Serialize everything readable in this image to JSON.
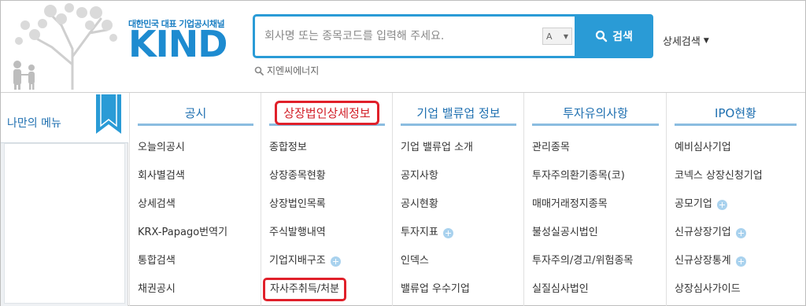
{
  "header": {
    "logo_tagline": "대한민국 대표 기업공시채널",
    "logo_text": "KIND",
    "search_placeholder": "회사명 또는 종목코드를 입력해 주세요.",
    "lang_label": "A",
    "search_button": "검색",
    "advanced_search": "상세검색",
    "recent_keyword": "지엔씨에너지"
  },
  "my_menu": {
    "title": "나만의 메뉴"
  },
  "columns": [
    {
      "title": "공시",
      "highlight": false,
      "items": [
        {
          "label": "오늘의공시",
          "plus": false,
          "highlight": false
        },
        {
          "label": "회사별검색",
          "plus": false,
          "highlight": false
        },
        {
          "label": "상세검색",
          "plus": false,
          "highlight": false
        },
        {
          "label": "KRX-Papago번역기",
          "plus": false,
          "highlight": false
        },
        {
          "label": "통합검색",
          "plus": false,
          "highlight": false
        },
        {
          "label": "채권공시",
          "plus": false,
          "highlight": false
        }
      ]
    },
    {
      "title": "상장법인상세정보",
      "highlight": true,
      "items": [
        {
          "label": "종합정보",
          "plus": false,
          "highlight": false
        },
        {
          "label": "상장종목현황",
          "plus": false,
          "highlight": false
        },
        {
          "label": "상장법인목록",
          "plus": false,
          "highlight": false
        },
        {
          "label": "주식발행내역",
          "plus": false,
          "highlight": false
        },
        {
          "label": "기업지배구조",
          "plus": true,
          "highlight": false
        },
        {
          "label": "자사주취득/처분",
          "plus": false,
          "highlight": true
        }
      ]
    },
    {
      "title": "기업 밸류업 정보",
      "highlight": false,
      "items": [
        {
          "label": "기업 밸류업 소개",
          "plus": false,
          "highlight": false
        },
        {
          "label": "공지사항",
          "plus": false,
          "highlight": false
        },
        {
          "label": "공시현황",
          "plus": false,
          "highlight": false
        },
        {
          "label": "투자지표",
          "plus": true,
          "highlight": false
        },
        {
          "label": "인덱스",
          "plus": false,
          "highlight": false
        },
        {
          "label": "밸류업 우수기업",
          "plus": false,
          "highlight": false
        }
      ]
    },
    {
      "title": "투자유의사항",
      "highlight": false,
      "items": [
        {
          "label": "관리종목",
          "plus": false,
          "highlight": false
        },
        {
          "label": "투자주의환기종목(코)",
          "plus": false,
          "highlight": false
        },
        {
          "label": "매매거래정지종목",
          "plus": false,
          "highlight": false
        },
        {
          "label": "불성실공시법인",
          "plus": false,
          "highlight": false
        },
        {
          "label": "투자주의/경고/위험종목",
          "plus": false,
          "highlight": false
        },
        {
          "label": "실질심사법인",
          "plus": false,
          "highlight": false
        }
      ]
    },
    {
      "title": "IPO현황",
      "highlight": false,
      "items": [
        {
          "label": "예비심사기업",
          "plus": false,
          "highlight": false
        },
        {
          "label": "코넥스 상장신청기업",
          "plus": false,
          "highlight": false
        },
        {
          "label": "공모기업",
          "plus": true,
          "highlight": false
        },
        {
          "label": "신규상장기업",
          "plus": true,
          "highlight": false
        },
        {
          "label": "신규상장통계",
          "plus": true,
          "highlight": false
        },
        {
          "label": "상장심사가이드",
          "plus": false,
          "highlight": false
        }
      ]
    }
  ],
  "colors": {
    "brand_blue": "#2a9bd6",
    "menu_blue": "#1e6fb0",
    "highlight_red": "#e0202a"
  }
}
